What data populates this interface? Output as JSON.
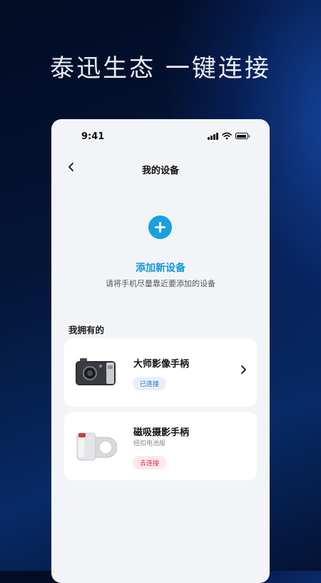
{
  "headline": "泰迅生态 一键连接",
  "status_bar": {
    "time": "9:41"
  },
  "nav": {
    "back_icon": "chevron-left-icon",
    "title": "我的设备"
  },
  "add_device": {
    "icon": "plus-icon",
    "title": "添加新设备",
    "subtitle": "请将手机尽量靠近要添加的设备"
  },
  "section": {
    "owned_label": "我拥有的"
  },
  "devices": [
    {
      "name": "大师影像手柄",
      "subtitle": "",
      "status": "已连接",
      "status_color": "#2a6fd0"
    },
    {
      "name": "磁吸摄影手柄",
      "subtitle": "纽扣电池版",
      "status": "去连接",
      "status_color": "#d8334a"
    }
  ],
  "colors": {
    "accent": "#1aa0e0",
    "background": "#041536"
  }
}
